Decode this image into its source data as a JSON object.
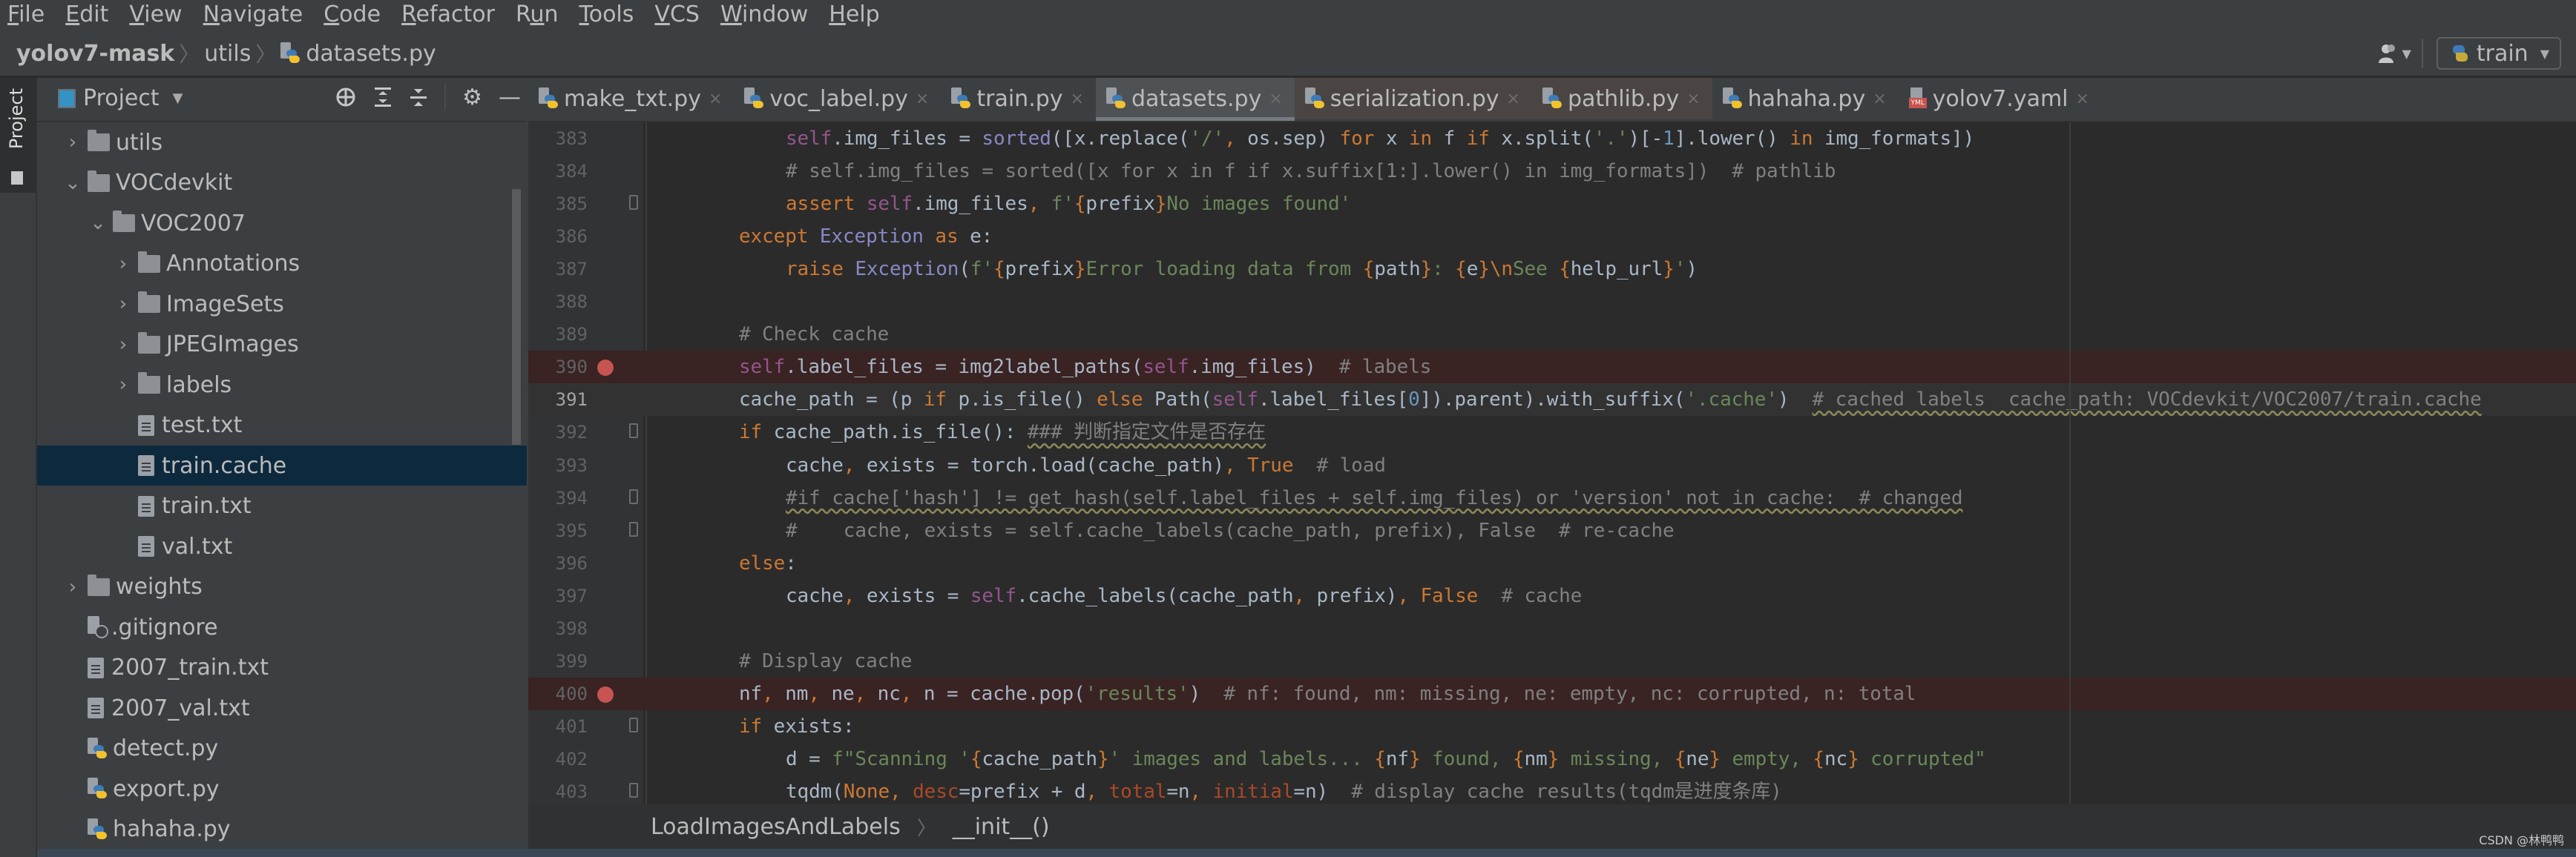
{
  "menu": [
    {
      "label": "File",
      "mnemonic": "F",
      "rest": "ile"
    },
    {
      "label": "Edit",
      "mnemonic": "E",
      "rest": "dit"
    },
    {
      "label": "View",
      "mnemonic": "V",
      "rest": "iew"
    },
    {
      "label": "Navigate",
      "mnemonic": "N",
      "rest": "avigate"
    },
    {
      "label": "Code",
      "mnemonic": "C",
      "rest": "ode"
    },
    {
      "label": "Refactor",
      "mnemonic": "R",
      "rest": "efactor"
    },
    {
      "label": "Run",
      "mnemonic": "R",
      "rest": "un",
      "prefix": ""
    },
    {
      "label": "Tools",
      "mnemonic": "T",
      "rest": "ools"
    },
    {
      "label": "VCS",
      "mnemonic": "V",
      "rest": "CS"
    },
    {
      "label": "Window",
      "mnemonic": "W",
      "rest": "indow"
    },
    {
      "label": "Help",
      "mnemonic": "H",
      "rest": "elp"
    }
  ],
  "breadcrumb": {
    "project": "yolov7-mask",
    "folder": "utils",
    "file": "datasets.py",
    "separator": "〉"
  },
  "toolbar": {
    "vcs_icon": "users-icon",
    "run_config": "train"
  },
  "tool_strip": {
    "project_tab": "Project"
  },
  "project_panel": {
    "title": "Project",
    "tools": [
      "locate-icon",
      "expand-all-icon",
      "collapse-all-icon",
      "gear-icon",
      "minimize-icon"
    ],
    "tree": [
      {
        "label": "utils",
        "type": "folder",
        "depth": 1,
        "expanded": false
      },
      {
        "label": "VOCdevkit",
        "type": "folder",
        "depth": 1,
        "expanded": true
      },
      {
        "label": "VOC2007",
        "type": "folder",
        "depth": 2,
        "expanded": true
      },
      {
        "label": "Annotations",
        "type": "folder",
        "depth": 3,
        "expanded": false
      },
      {
        "label": "ImageSets",
        "type": "folder",
        "depth": 3,
        "expanded": false
      },
      {
        "label": "JPEGImages",
        "type": "folder",
        "depth": 3,
        "expanded": false
      },
      {
        "label": "labels",
        "type": "folder",
        "depth": 3,
        "expanded": false
      },
      {
        "label": "test.txt",
        "type": "text",
        "depth": 3
      },
      {
        "label": "train.cache",
        "type": "text",
        "depth": 3,
        "selected": true
      },
      {
        "label": "train.txt",
        "type": "text",
        "depth": 3
      },
      {
        "label": "val.txt",
        "type": "text",
        "depth": 3
      },
      {
        "label": "weights",
        "type": "folder",
        "depth": 1,
        "expanded": false
      },
      {
        "label": ".gitignore",
        "type": "gitignore",
        "depth": 1
      },
      {
        "label": "2007_train.txt",
        "type": "text",
        "depth": 1
      },
      {
        "label": "2007_val.txt",
        "type": "text",
        "depth": 1
      },
      {
        "label": "detect.py",
        "type": "python",
        "depth": 1
      },
      {
        "label": "export.py",
        "type": "python",
        "depth": 1
      },
      {
        "label": "hahaha.py",
        "type": "python",
        "depth": 1
      }
    ]
  },
  "tabs": [
    {
      "label": "make_txt.py",
      "type": "python"
    },
    {
      "label": "voc_label.py",
      "type": "python"
    },
    {
      "label": "train.py",
      "type": "python"
    },
    {
      "label": "datasets.py",
      "type": "python",
      "active": true
    },
    {
      "label": "serialization.py",
      "type": "python",
      "library": true
    },
    {
      "label": "pathlib.py",
      "type": "python",
      "library": true
    },
    {
      "label": "hahaha.py",
      "type": "python"
    },
    {
      "label": "yolov7.yaml",
      "type": "yaml"
    }
  ],
  "editor": {
    "lines": [
      {
        "n": "383",
        "indent": 1,
        "fold": false,
        "tokens": [
          [
            "sf",
            "self"
          ],
          [
            "",
            "."
          ],
          [
            "",
            "img_files = "
          ],
          [
            "bi",
            "sorted"
          ],
          [
            "",
            "([x.replace("
          ],
          [
            "st",
            "'/'"
          ],
          [
            "br",
            ", "
          ],
          [
            "",
            "os.sep) "
          ],
          [
            "kw",
            "for "
          ],
          [
            "",
            "x "
          ],
          [
            "kw",
            "in "
          ],
          [
            "",
            "f "
          ],
          [
            "kw",
            "if "
          ],
          [
            "",
            "x.split("
          ],
          [
            "st",
            "'.'"
          ],
          [
            "",
            ")[-"
          ],
          [
            "nm",
            "1"
          ],
          [
            "",
            "].lower() "
          ],
          [
            "kw",
            "in "
          ],
          [
            "",
            "img_formats])"
          ]
        ]
      },
      {
        "n": "384",
        "indent": 1,
        "tokens": [
          [
            "cm",
            "# self.img_files = sorted([x for x in f if x.suffix[1:].lower() in img_formats])  # pathlib"
          ]
        ]
      },
      {
        "n": "385",
        "indent": 1,
        "fold": true,
        "tokens": [
          [
            "kw",
            "assert "
          ],
          [
            "sf",
            "self"
          ],
          [
            "",
            ".img_files"
          ],
          [
            "br",
            ", "
          ],
          [
            "st",
            "f'"
          ],
          [
            "br",
            "{"
          ],
          [
            "",
            "prefix"
          ],
          [
            "br",
            "}"
          ],
          [
            "st",
            "No images found'"
          ]
        ]
      },
      {
        "n": "386",
        "indent": 0,
        "tokens": [
          [
            "kw",
            "except "
          ],
          [
            "bi",
            "Exception "
          ],
          [
            "kw",
            "as "
          ],
          [
            "",
            "e:"
          ]
        ]
      },
      {
        "n": "387",
        "indent": 1,
        "tokens": [
          [
            "kw",
            "raise "
          ],
          [
            "bi",
            "Exception"
          ],
          [
            "",
            "("
          ],
          [
            "st",
            "f'"
          ],
          [
            "br",
            "{"
          ],
          [
            "",
            "prefix"
          ],
          [
            "br",
            "}"
          ],
          [
            "st",
            "Error loading data from "
          ],
          [
            "br",
            "{"
          ],
          [
            "",
            "path"
          ],
          [
            "br",
            "}"
          ],
          [
            "st",
            ": "
          ],
          [
            "br",
            "{"
          ],
          [
            "",
            "e"
          ],
          [
            "br",
            "}"
          ],
          [
            "kw",
            "\\n"
          ],
          [
            "st",
            "See "
          ],
          [
            "br",
            "{"
          ],
          [
            "",
            "help_url"
          ],
          [
            "br",
            "}"
          ],
          [
            "st",
            "'"
          ],
          [
            "",
            ")"
          ]
        ]
      },
      {
        "n": "388",
        "indent": 0,
        "tokens": []
      },
      {
        "n": "389",
        "indent": 0,
        "tokens": [
          [
            "cm",
            "# Check cache"
          ]
        ]
      },
      {
        "n": "390",
        "indent": 0,
        "breakpoint": true,
        "tokens": [
          [
            "sf",
            "self"
          ],
          [
            "",
            ".label_files = img2label_paths("
          ],
          [
            "sf",
            "self"
          ],
          [
            "",
            ".img_files)  "
          ],
          [
            "cm",
            "# labels"
          ]
        ]
      },
      {
        "n": "391",
        "indent": 0,
        "caret": true,
        "tokens": [
          [
            "",
            "cache_path = (p "
          ],
          [
            "kw",
            "if "
          ],
          [
            "",
            "p.is_file() "
          ],
          [
            "kw",
            "else "
          ],
          [
            "",
            "Path("
          ],
          [
            "sf",
            "self"
          ],
          [
            "",
            ".label_files["
          ],
          [
            "nm",
            "0"
          ],
          [
            "",
            "]).parent).with_suffix("
          ],
          [
            "st",
            "'.cache'"
          ],
          [
            "",
            ")  "
          ],
          [
            "cmw",
            "# cached labels  cache_path: VOCdevkit/VOC2007/train.cache"
          ]
        ]
      },
      {
        "n": "392",
        "indent": 0,
        "fold": true,
        "tokens": [
          [
            "kw",
            "if "
          ],
          [
            "",
            "cache_path.is_file(): "
          ],
          [
            "cmw",
            "### 判断指定文件是否存在"
          ]
        ]
      },
      {
        "n": "393",
        "indent": 1,
        "tokens": [
          [
            "",
            "cache"
          ],
          [
            "br",
            ", "
          ],
          [
            "",
            "exists = torch.load(cache_path)"
          ],
          [
            "br",
            ", "
          ],
          [
            "kw",
            "True  "
          ],
          [
            "cm",
            "# load"
          ]
        ]
      },
      {
        "n": "394",
        "indent": 1,
        "fold": true,
        "tokens": [
          [
            "cmw",
            "#if cache['hash'] != get_hash(self.label_files + self.img_files) or 'version' not in cache:  # changed"
          ]
        ]
      },
      {
        "n": "395",
        "indent": 1,
        "fold": true,
        "tokens": [
          [
            "cm",
            "#    cache, exists = self.cache_labels(cache_path, prefix), False  # re-cache"
          ]
        ]
      },
      {
        "n": "396",
        "indent": 0,
        "tokens": [
          [
            "kw",
            "else"
          ],
          [
            "",
            ":"
          ]
        ]
      },
      {
        "n": "397",
        "indent": 1,
        "tokens": [
          [
            "",
            "cache"
          ],
          [
            "br",
            ", "
          ],
          [
            "",
            "exists = "
          ],
          [
            "sf",
            "self"
          ],
          [
            "",
            ".cache_labels(cache_path"
          ],
          [
            "br",
            ", "
          ],
          [
            "",
            "prefix)"
          ],
          [
            "br",
            ", "
          ],
          [
            "kw",
            "False  "
          ],
          [
            "cm",
            "# cache"
          ]
        ]
      },
      {
        "n": "398",
        "indent": 0,
        "tokens": []
      },
      {
        "n": "399",
        "indent": 0,
        "tokens": [
          [
            "cm",
            "# Display cache"
          ]
        ]
      },
      {
        "n": "400",
        "indent": 0,
        "breakpoint": true,
        "tokens": [
          [
            "",
            "nf"
          ],
          [
            "br",
            ", "
          ],
          [
            "",
            "nm"
          ],
          [
            "br",
            ", "
          ],
          [
            "",
            "ne"
          ],
          [
            "br",
            ", "
          ],
          [
            "",
            "nc"
          ],
          [
            "br",
            ", "
          ],
          [
            "",
            "n = cache.pop("
          ],
          [
            "st",
            "'results'"
          ],
          [
            "",
            ")  "
          ],
          [
            "cm",
            "# nf: found, nm: missing, ne: empty, nc: corrupted, n: total"
          ]
        ]
      },
      {
        "n": "401",
        "indent": 0,
        "fold": true,
        "tokens": [
          [
            "kw",
            "if "
          ],
          [
            "",
            "exists:"
          ]
        ]
      },
      {
        "n": "402",
        "indent": 1,
        "tokens": [
          [
            "",
            "d = "
          ],
          [
            "st",
            "f\"Scanning '"
          ],
          [
            "br",
            "{"
          ],
          [
            "",
            "cache_path"
          ],
          [
            "br",
            "}"
          ],
          [
            "st",
            "' images and labels... "
          ],
          [
            "br",
            "{"
          ],
          [
            "",
            "nf"
          ],
          [
            "br",
            "}"
          ],
          [
            "st",
            " found, "
          ],
          [
            "br",
            "{"
          ],
          [
            "",
            "nm"
          ],
          [
            "br",
            "}"
          ],
          [
            "st",
            " missing, "
          ],
          [
            "br",
            "{"
          ],
          [
            "",
            "ne"
          ],
          [
            "br",
            "}"
          ],
          [
            "st",
            " empty, "
          ],
          [
            "br",
            "{"
          ],
          [
            "",
            "nc"
          ],
          [
            "br",
            "}"
          ],
          [
            "st",
            " corrupted\""
          ]
        ]
      },
      {
        "n": "403",
        "indent": 1,
        "fold": true,
        "tokens": [
          [
            "",
            "tqdm("
          ],
          [
            "kw",
            "None"
          ],
          [
            "br",
            ", "
          ],
          [
            "pa",
            "desc"
          ],
          [
            "",
            "=prefix + d"
          ],
          [
            "br",
            ", "
          ],
          [
            "pa",
            "total"
          ],
          [
            "",
            "=n"
          ],
          [
            "br",
            ", "
          ],
          [
            "pa",
            "initial"
          ],
          [
            "",
            "=n)  "
          ],
          [
            "cm",
            "# display cache results(tqdm是进度条库)"
          ]
        ]
      }
    ]
  },
  "editor_breadcrumb": {
    "class_name": "LoadImagesAndLabels",
    "method_name": "__init__()"
  },
  "watermark": "CSDN @林鸭鸭",
  "colors": {
    "keyword": "#cc7832",
    "self": "#94558d",
    "builtin": "#8888c6",
    "string": "#6a8759",
    "comment": "#808080",
    "number": "#6897bb",
    "breakpoint": "#c75450",
    "selection": "#0d293e"
  }
}
